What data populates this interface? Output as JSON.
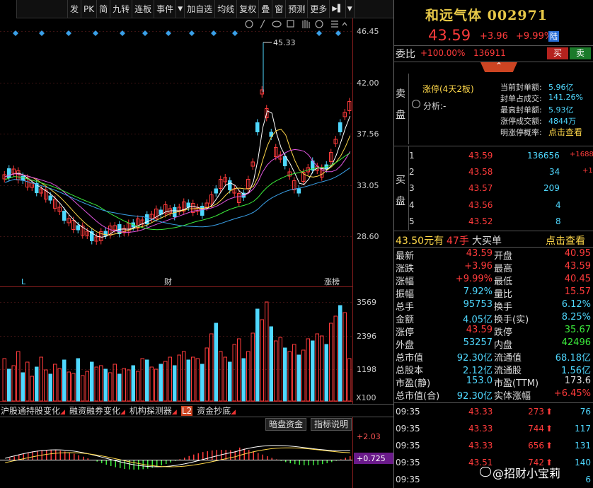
{
  "toolbar": {
    "items": [
      "发",
      "PK",
      "简",
      "九转",
      "连板",
      "事件",
      "▼",
      "加自选",
      "均线",
      "复权",
      "叠",
      "窗",
      "预测",
      "更多",
      "▶▌",
      "▼"
    ]
  },
  "chart": {
    "price_axis": [
      "46.45",
      "42.00",
      "37.56",
      "33.05",
      "28.60"
    ],
    "high_label": "45.33",
    "markers": [
      "L",
      "财",
      "涨榜"
    ],
    "volume_axis": [
      "3569",
      "2396",
      "1198"
    ],
    "volume_unit": "X100",
    "macd_axis": [
      "+2.03",
      "+0.725"
    ]
  },
  "indicator_tabs": [
    {
      "label": "沪股通持股变化"
    },
    {
      "label": "融资融券变化"
    },
    {
      "label": "机构探测器"
    },
    {
      "label": "L2",
      "badge": true
    },
    {
      "label": "资金抄底"
    }
  ],
  "indicator_buttons": [
    "暗盘资金",
    "指标说明"
  ],
  "stock": {
    "name": "和远气体",
    "code": "002971",
    "price": "43.59",
    "change": "+3.96",
    "change_pct": "+9.99%",
    "board_tag": "陆"
  },
  "weibi": {
    "label": "委比",
    "value": "+100.00%",
    "count": "136911",
    "buy_label": "买",
    "sell_label": "卖"
  },
  "limit_up": {
    "sell_side_label": "卖盘",
    "status": "涨停(4天2板)",
    "analysis": "分析:-",
    "rows": [
      {
        "label": "当前封单额:",
        "value": "5.96亿"
      },
      {
        "label": "封单占成交:",
        "value": "141.26%"
      },
      {
        "label": "最高封单额:",
        "value": "5.93亿"
      },
      {
        "label": "涨停成交额:",
        "value": "4844万"
      },
      {
        "label": "明涨停概率:",
        "value": "点击查看"
      }
    ]
  },
  "buy_side": {
    "label": "买盘",
    "rows": [
      {
        "level": "1",
        "price": "43.59",
        "volume": "136656",
        "delta": "+1688"
      },
      {
        "level": "2",
        "price": "43.58",
        "volume": "34",
        "delta": "+1"
      },
      {
        "level": "3",
        "price": "43.57",
        "volume": "209",
        "delta": ""
      },
      {
        "level": "4",
        "price": "43.56",
        "volume": "4",
        "delta": ""
      },
      {
        "level": "5",
        "price": "43.52",
        "volume": "8",
        "delta": ""
      }
    ]
  },
  "big_order": {
    "price": "43.50元有",
    "hands": "47手",
    "label": "大买单",
    "link": "点击查看"
  },
  "quote": [
    {
      "l1": "最新",
      "v1": "43.59",
      "l2": "开盘",
      "v2": "40.95"
    },
    {
      "l1": "涨跌",
      "v1": "+3.96",
      "l2": "最高",
      "v2": "43.59"
    },
    {
      "l1": "涨幅",
      "v1": "+9.99%",
      "l2": "最低",
      "v2": "40.45"
    },
    {
      "l1": "振幅",
      "v1": "7.92%",
      "l2": "量比",
      "v2": "15.57"
    },
    {
      "l1": "总手",
      "v1": "95753",
      "l2": "换手",
      "v2": "6.12%"
    },
    {
      "l1": "金额",
      "v1": "4.05亿",
      "l2": "换手(实)",
      "v2": "8.25%"
    },
    {
      "l1": "涨停",
      "v1": "43.59",
      "l2": "跌停",
      "v2": "35.67"
    },
    {
      "l1": "外盘",
      "v1": "53257",
      "l2": "内盘",
      "v2": "42496"
    },
    {
      "l1": "总市值",
      "v1": "92.30亿",
      "l2": "流通值",
      "v2": "68.18亿"
    },
    {
      "l1": "总股本",
      "v1": "2.12亿",
      "l2": "流通股",
      "v2": "1.56亿"
    },
    {
      "l1": "市盈(静)",
      "v1": "153.0",
      "l2": "市盈(TTM)",
      "v2": "173.6"
    },
    {
      "l1": "总市值(合)",
      "v1": "92.30亿",
      "l2": "实体涨幅",
      "v2": "+6.45%"
    }
  ],
  "ticks": [
    {
      "time": "09:35",
      "price": "43.33",
      "volume": "273",
      "count": "76"
    },
    {
      "time": "09:35",
      "price": "43.33",
      "volume": "744",
      "count": "117"
    },
    {
      "time": "09:35",
      "price": "43.33",
      "volume": "656",
      "count": "131"
    },
    {
      "time": "09:35",
      "price": "43.51",
      "volume": "742",
      "count": "140"
    },
    {
      "time": "09:35",
      "price": "",
      "volume": "",
      "count": "6"
    }
  ],
  "watermark": "@招财小宝莉",
  "colors": {
    "up": "#ff3b3b",
    "down": "#4fd8ff",
    "gold": "#e8c948",
    "green": "#3bea3b"
  }
}
